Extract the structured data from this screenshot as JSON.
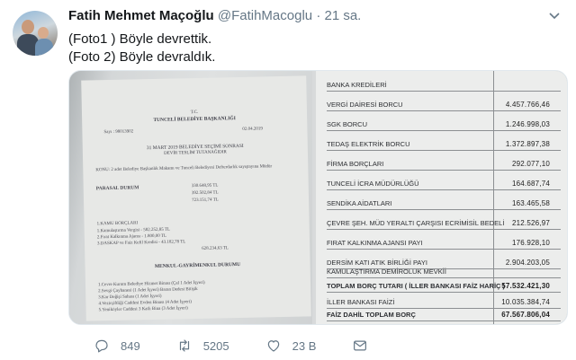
{
  "tweet": {
    "author_name": "Fatih Mehmet Maçoğlu",
    "author_handle": "@FatihMacoglu",
    "separator": "·",
    "timestamp": "21 sa.",
    "line1": "(Foto1 ) Böyle devrettik.",
    "line2": "(Foto 2) Böyle devraldık."
  },
  "photo1": {
    "lines": [
      "T.C.",
      "TUNCELİ BELEDİYE BAŞKANLIĞI",
      "31 MART 2019 BELEDİYE SEÇİMİ SONRASI",
      "DEVİR TESLİM TUTANAĞIDIR",
      "PARASAL DURUM",
      "MENKUL-GAYRİMENKUL DURUMU"
    ]
  },
  "photo2": {
    "rows": [
      {
        "label": "BANKA KREDİLERİ",
        "value": ""
      },
      {
        "label": "VERGİ DAİRESİ BORCU",
        "value": "4.457.766,46"
      },
      {
        "label": "SGK BORCU",
        "value": "1.246.998,03"
      },
      {
        "label": "TEDAŞ ELEKTRİK BORCU",
        "value": "1.372.897,38"
      },
      {
        "label": "FİRMA BORÇLARI",
        "value": "292.077,10"
      },
      {
        "label": "TUNCELİ İCRA MÜDÜRLÜĞÜ",
        "value": "164.687,74"
      },
      {
        "label": "SENDİKA AİDATLARI",
        "value": "163.465,58"
      },
      {
        "label": "ÇEVRE ŞEH. MÜD YERALTI ÇARŞISI ECRİMİSİL BEDELİ",
        "value": "212.526,97"
      },
      {
        "label": "FIRAT KALKINMA AJANSI PAYI",
        "value": "176.928,10"
      },
      {
        "label": "DERSİM KATI ATIK BİRLİĞİ PAYI",
        "value": "2.904.203,05"
      },
      {
        "label": "KAMULAŞTIRMA DEMİROLUK MEVKİİ",
        "value": ""
      },
      {
        "label": "TOPLAM BORÇ TUTARI ( İLLER BANKASI FAİZ HARİÇ )",
        "value": "57.532.421,30"
      },
      {
        "label": "İLLER BANKASI FAİZİ",
        "value": "10.035.384,74"
      },
      {
        "label": "FAİZ DAHİL TOPLAM BORÇ",
        "value": "67.567.806,04"
      }
    ]
  },
  "actions": {
    "reply_count": "849",
    "retweet_count": "5205",
    "like_count": "23 B"
  }
}
